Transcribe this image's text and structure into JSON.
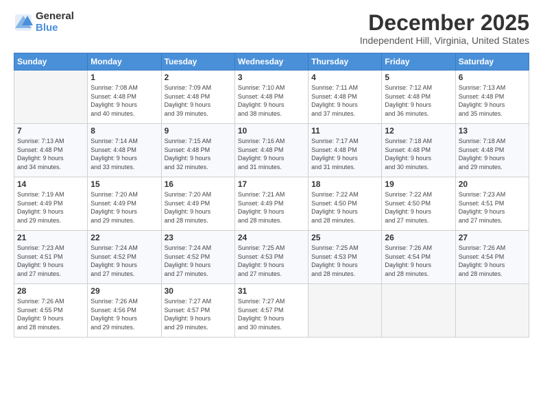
{
  "logo": {
    "general": "General",
    "blue": "Blue"
  },
  "title": "December 2025",
  "location": "Independent Hill, Virginia, United States",
  "days_header": [
    "Sunday",
    "Monday",
    "Tuesday",
    "Wednesday",
    "Thursday",
    "Friday",
    "Saturday"
  ],
  "weeks": [
    [
      {
        "day": "",
        "info": ""
      },
      {
        "day": "1",
        "info": "Sunrise: 7:08 AM\nSunset: 4:48 PM\nDaylight: 9 hours\nand 40 minutes."
      },
      {
        "day": "2",
        "info": "Sunrise: 7:09 AM\nSunset: 4:48 PM\nDaylight: 9 hours\nand 39 minutes."
      },
      {
        "day": "3",
        "info": "Sunrise: 7:10 AM\nSunset: 4:48 PM\nDaylight: 9 hours\nand 38 minutes."
      },
      {
        "day": "4",
        "info": "Sunrise: 7:11 AM\nSunset: 4:48 PM\nDaylight: 9 hours\nand 37 minutes."
      },
      {
        "day": "5",
        "info": "Sunrise: 7:12 AM\nSunset: 4:48 PM\nDaylight: 9 hours\nand 36 minutes."
      },
      {
        "day": "6",
        "info": "Sunrise: 7:13 AM\nSunset: 4:48 PM\nDaylight: 9 hours\nand 35 minutes."
      }
    ],
    [
      {
        "day": "7",
        "info": "Sunrise: 7:13 AM\nSunset: 4:48 PM\nDaylight: 9 hours\nand 34 minutes."
      },
      {
        "day": "8",
        "info": "Sunrise: 7:14 AM\nSunset: 4:48 PM\nDaylight: 9 hours\nand 33 minutes."
      },
      {
        "day": "9",
        "info": "Sunrise: 7:15 AM\nSunset: 4:48 PM\nDaylight: 9 hours\nand 32 minutes."
      },
      {
        "day": "10",
        "info": "Sunrise: 7:16 AM\nSunset: 4:48 PM\nDaylight: 9 hours\nand 31 minutes."
      },
      {
        "day": "11",
        "info": "Sunrise: 7:17 AM\nSunset: 4:48 PM\nDaylight: 9 hours\nand 31 minutes."
      },
      {
        "day": "12",
        "info": "Sunrise: 7:18 AM\nSunset: 4:48 PM\nDaylight: 9 hours\nand 30 minutes."
      },
      {
        "day": "13",
        "info": "Sunrise: 7:18 AM\nSunset: 4:48 PM\nDaylight: 9 hours\nand 29 minutes."
      }
    ],
    [
      {
        "day": "14",
        "info": "Sunrise: 7:19 AM\nSunset: 4:49 PM\nDaylight: 9 hours\nand 29 minutes."
      },
      {
        "day": "15",
        "info": "Sunrise: 7:20 AM\nSunset: 4:49 PM\nDaylight: 9 hours\nand 29 minutes."
      },
      {
        "day": "16",
        "info": "Sunrise: 7:20 AM\nSunset: 4:49 PM\nDaylight: 9 hours\nand 28 minutes."
      },
      {
        "day": "17",
        "info": "Sunrise: 7:21 AM\nSunset: 4:49 PM\nDaylight: 9 hours\nand 28 minutes."
      },
      {
        "day": "18",
        "info": "Sunrise: 7:22 AM\nSunset: 4:50 PM\nDaylight: 9 hours\nand 28 minutes."
      },
      {
        "day": "19",
        "info": "Sunrise: 7:22 AM\nSunset: 4:50 PM\nDaylight: 9 hours\nand 27 minutes."
      },
      {
        "day": "20",
        "info": "Sunrise: 7:23 AM\nSunset: 4:51 PM\nDaylight: 9 hours\nand 27 minutes."
      }
    ],
    [
      {
        "day": "21",
        "info": "Sunrise: 7:23 AM\nSunset: 4:51 PM\nDaylight: 9 hours\nand 27 minutes."
      },
      {
        "day": "22",
        "info": "Sunrise: 7:24 AM\nSunset: 4:52 PM\nDaylight: 9 hours\nand 27 minutes."
      },
      {
        "day": "23",
        "info": "Sunrise: 7:24 AM\nSunset: 4:52 PM\nDaylight: 9 hours\nand 27 minutes."
      },
      {
        "day": "24",
        "info": "Sunrise: 7:25 AM\nSunset: 4:53 PM\nDaylight: 9 hours\nand 27 minutes."
      },
      {
        "day": "25",
        "info": "Sunrise: 7:25 AM\nSunset: 4:53 PM\nDaylight: 9 hours\nand 28 minutes."
      },
      {
        "day": "26",
        "info": "Sunrise: 7:26 AM\nSunset: 4:54 PM\nDaylight: 9 hours\nand 28 minutes."
      },
      {
        "day": "27",
        "info": "Sunrise: 7:26 AM\nSunset: 4:54 PM\nDaylight: 9 hours\nand 28 minutes."
      }
    ],
    [
      {
        "day": "28",
        "info": "Sunrise: 7:26 AM\nSunset: 4:55 PM\nDaylight: 9 hours\nand 28 minutes."
      },
      {
        "day": "29",
        "info": "Sunrise: 7:26 AM\nSunset: 4:56 PM\nDaylight: 9 hours\nand 29 minutes."
      },
      {
        "day": "30",
        "info": "Sunrise: 7:27 AM\nSunset: 4:57 PM\nDaylight: 9 hours\nand 29 minutes."
      },
      {
        "day": "31",
        "info": "Sunrise: 7:27 AM\nSunset: 4:57 PM\nDaylight: 9 hours\nand 30 minutes."
      },
      {
        "day": "",
        "info": ""
      },
      {
        "day": "",
        "info": ""
      },
      {
        "day": "",
        "info": ""
      }
    ]
  ]
}
